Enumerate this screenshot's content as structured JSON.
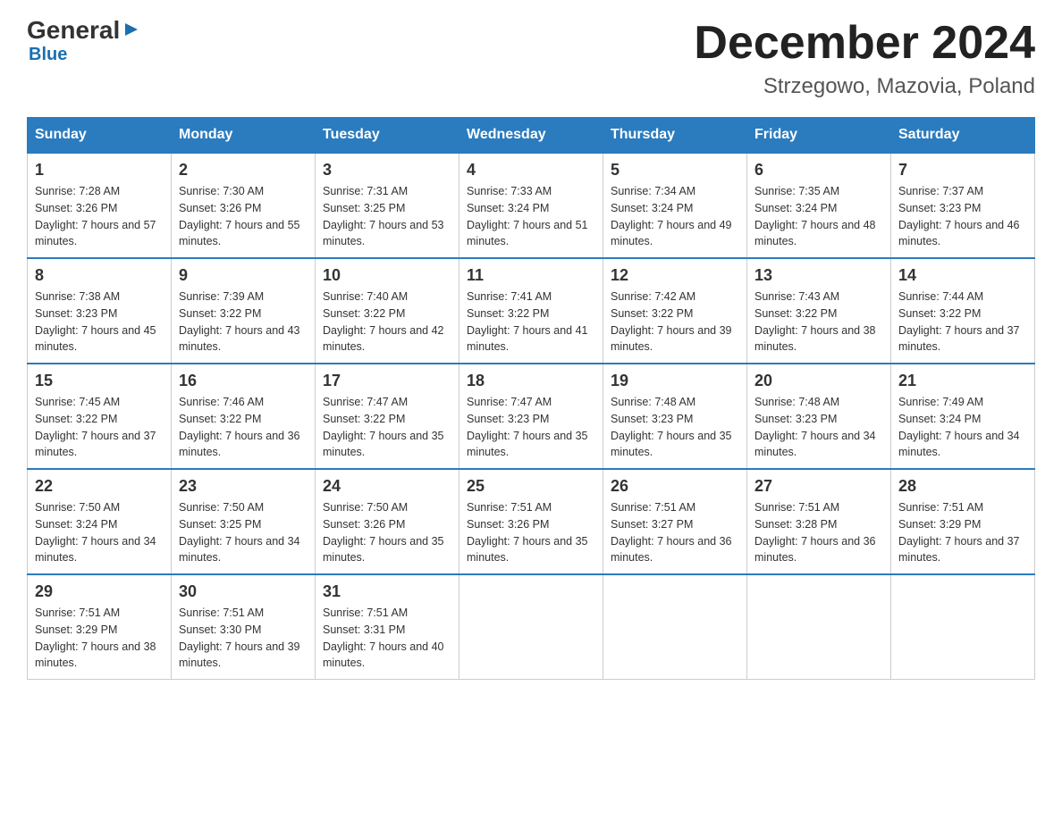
{
  "logo": {
    "general": "General",
    "triangle": "▶",
    "blue": "Blue"
  },
  "title": "December 2024",
  "subtitle": "Strzegowo, Mazovia, Poland",
  "days_of_week": [
    "Sunday",
    "Monday",
    "Tuesday",
    "Wednesday",
    "Thursday",
    "Friday",
    "Saturday"
  ],
  "weeks": [
    [
      {
        "day": "1",
        "sunrise": "7:28 AM",
        "sunset": "3:26 PM",
        "daylight": "7 hours and 57 minutes."
      },
      {
        "day": "2",
        "sunrise": "7:30 AM",
        "sunset": "3:26 PM",
        "daylight": "7 hours and 55 minutes."
      },
      {
        "day": "3",
        "sunrise": "7:31 AM",
        "sunset": "3:25 PM",
        "daylight": "7 hours and 53 minutes."
      },
      {
        "day": "4",
        "sunrise": "7:33 AM",
        "sunset": "3:24 PM",
        "daylight": "7 hours and 51 minutes."
      },
      {
        "day": "5",
        "sunrise": "7:34 AM",
        "sunset": "3:24 PM",
        "daylight": "7 hours and 49 minutes."
      },
      {
        "day": "6",
        "sunrise": "7:35 AM",
        "sunset": "3:24 PM",
        "daylight": "7 hours and 48 minutes."
      },
      {
        "day": "7",
        "sunrise": "7:37 AM",
        "sunset": "3:23 PM",
        "daylight": "7 hours and 46 minutes."
      }
    ],
    [
      {
        "day": "8",
        "sunrise": "7:38 AM",
        "sunset": "3:23 PM",
        "daylight": "7 hours and 45 minutes."
      },
      {
        "day": "9",
        "sunrise": "7:39 AM",
        "sunset": "3:22 PM",
        "daylight": "7 hours and 43 minutes."
      },
      {
        "day": "10",
        "sunrise": "7:40 AM",
        "sunset": "3:22 PM",
        "daylight": "7 hours and 42 minutes."
      },
      {
        "day": "11",
        "sunrise": "7:41 AM",
        "sunset": "3:22 PM",
        "daylight": "7 hours and 41 minutes."
      },
      {
        "day": "12",
        "sunrise": "7:42 AM",
        "sunset": "3:22 PM",
        "daylight": "7 hours and 39 minutes."
      },
      {
        "day": "13",
        "sunrise": "7:43 AM",
        "sunset": "3:22 PM",
        "daylight": "7 hours and 38 minutes."
      },
      {
        "day": "14",
        "sunrise": "7:44 AM",
        "sunset": "3:22 PM",
        "daylight": "7 hours and 37 minutes."
      }
    ],
    [
      {
        "day": "15",
        "sunrise": "7:45 AM",
        "sunset": "3:22 PM",
        "daylight": "7 hours and 37 minutes."
      },
      {
        "day": "16",
        "sunrise": "7:46 AM",
        "sunset": "3:22 PM",
        "daylight": "7 hours and 36 minutes."
      },
      {
        "day": "17",
        "sunrise": "7:47 AM",
        "sunset": "3:22 PM",
        "daylight": "7 hours and 35 minutes."
      },
      {
        "day": "18",
        "sunrise": "7:47 AM",
        "sunset": "3:23 PM",
        "daylight": "7 hours and 35 minutes."
      },
      {
        "day": "19",
        "sunrise": "7:48 AM",
        "sunset": "3:23 PM",
        "daylight": "7 hours and 35 minutes."
      },
      {
        "day": "20",
        "sunrise": "7:48 AM",
        "sunset": "3:23 PM",
        "daylight": "7 hours and 34 minutes."
      },
      {
        "day": "21",
        "sunrise": "7:49 AM",
        "sunset": "3:24 PM",
        "daylight": "7 hours and 34 minutes."
      }
    ],
    [
      {
        "day": "22",
        "sunrise": "7:50 AM",
        "sunset": "3:24 PM",
        "daylight": "7 hours and 34 minutes."
      },
      {
        "day": "23",
        "sunrise": "7:50 AM",
        "sunset": "3:25 PM",
        "daylight": "7 hours and 34 minutes."
      },
      {
        "day": "24",
        "sunrise": "7:50 AM",
        "sunset": "3:26 PM",
        "daylight": "7 hours and 35 minutes."
      },
      {
        "day": "25",
        "sunrise": "7:51 AM",
        "sunset": "3:26 PM",
        "daylight": "7 hours and 35 minutes."
      },
      {
        "day": "26",
        "sunrise": "7:51 AM",
        "sunset": "3:27 PM",
        "daylight": "7 hours and 36 minutes."
      },
      {
        "day": "27",
        "sunrise": "7:51 AM",
        "sunset": "3:28 PM",
        "daylight": "7 hours and 36 minutes."
      },
      {
        "day": "28",
        "sunrise": "7:51 AM",
        "sunset": "3:29 PM",
        "daylight": "7 hours and 37 minutes."
      }
    ],
    [
      {
        "day": "29",
        "sunrise": "7:51 AM",
        "sunset": "3:29 PM",
        "daylight": "7 hours and 38 minutes."
      },
      {
        "day": "30",
        "sunrise": "7:51 AM",
        "sunset": "3:30 PM",
        "daylight": "7 hours and 39 minutes."
      },
      {
        "day": "31",
        "sunrise": "7:51 AM",
        "sunset": "3:31 PM",
        "daylight": "7 hours and 40 minutes."
      },
      null,
      null,
      null,
      null
    ]
  ]
}
